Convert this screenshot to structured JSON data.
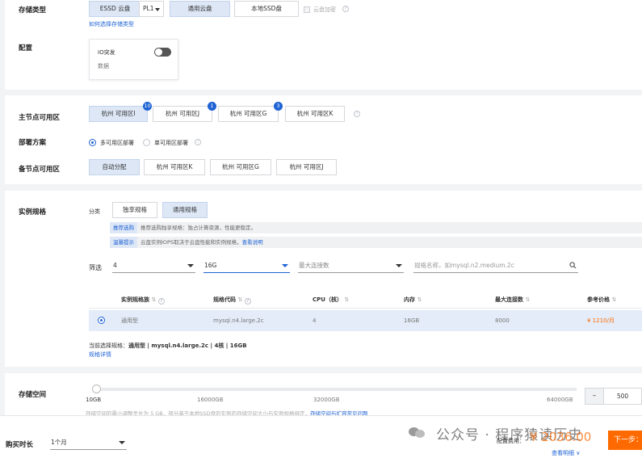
{
  "storage_type": {
    "label": "存储类型",
    "options": [
      "ESSD 云盘",
      "通用云盘",
      "本地SSD盘"
    ],
    "pl_value": "PL1",
    "encrypt_label": "云盘加密",
    "link": "如何选择存储类型"
  },
  "config": {
    "label": "配置",
    "io_burst_label": "IO突发",
    "io_sub_label": "数据"
  },
  "zone": {
    "primary_label": "主节点可用区",
    "primary_zones": [
      {
        "label": "杭州 可用区I",
        "badge": "10"
      },
      {
        "label": "杭州 可用区J",
        "badge": "1"
      },
      {
        "label": "杭州 可用区G",
        "badge": "3"
      },
      {
        "label": "杭州 可用区K",
        "badge": ""
      }
    ],
    "deploy_label": "部署方案",
    "deploy_multi": "多可用区部署",
    "deploy_single": "单可用区部署",
    "backup_label": "备节点可用区",
    "backup_zones": [
      "自动分配",
      "杭州 可用区K",
      "杭州 可用区G",
      "杭州 可用区J"
    ]
  },
  "instance": {
    "label": "实例规格",
    "category_label": "分类",
    "categories": [
      "独享规格",
      "通用规格"
    ],
    "tip1_tag": "推荐选购",
    "tip1_text": "推荐选购独享规格：独占计算资源，性能更稳定。",
    "tip2_tag": "温馨提示",
    "tip2_text": "云盘实例IOPS取决于云盘性能和实例规格，",
    "tip2_link": "查看说明",
    "filter_label": "筛选",
    "filter_cpu": "4",
    "filter_mem": "16G",
    "filter_conn_placeholder": "最大连接数",
    "search_placeholder": "规格名称，如mysql.n2.medium.2c",
    "columns": [
      "实例规格族",
      "规格代码",
      "CPU（核）",
      "内存",
      "最大连接数",
      "参考价格"
    ],
    "row": {
      "family": "通用型",
      "code": "mysql.n4.large.2c",
      "cpu": "4",
      "memory": "16GB",
      "conn": "8000",
      "price": "¥ 1210/月"
    },
    "current_label": "当前选择规格：",
    "current_value": "通用型 | mysql.n4.large.2c | 4核 | 16GB",
    "detail_link": "规格详情"
  },
  "storage_space": {
    "label": "存储空间",
    "ticks": [
      "10GB",
      "16000GB",
      "32000GB",
      "64000GB"
    ],
    "value": "500",
    "minus": "–",
    "note": "存储空间的最小调整步长为 5 GB，部分基于本地SSD盘的实例的存储空间大小与实例规格绑定，",
    "note_link": "存储空间与扩容常见问题"
  },
  "footer": {
    "duration_label": "购买时长",
    "duration_value": "1个月",
    "fee_label": "配置费用：",
    "fee_value": "¥ 2036.00",
    "detail_link": "查看明细 ∨",
    "next_button": "下一步：",
    "watermark": "公众号 · 程序猿读历史"
  }
}
